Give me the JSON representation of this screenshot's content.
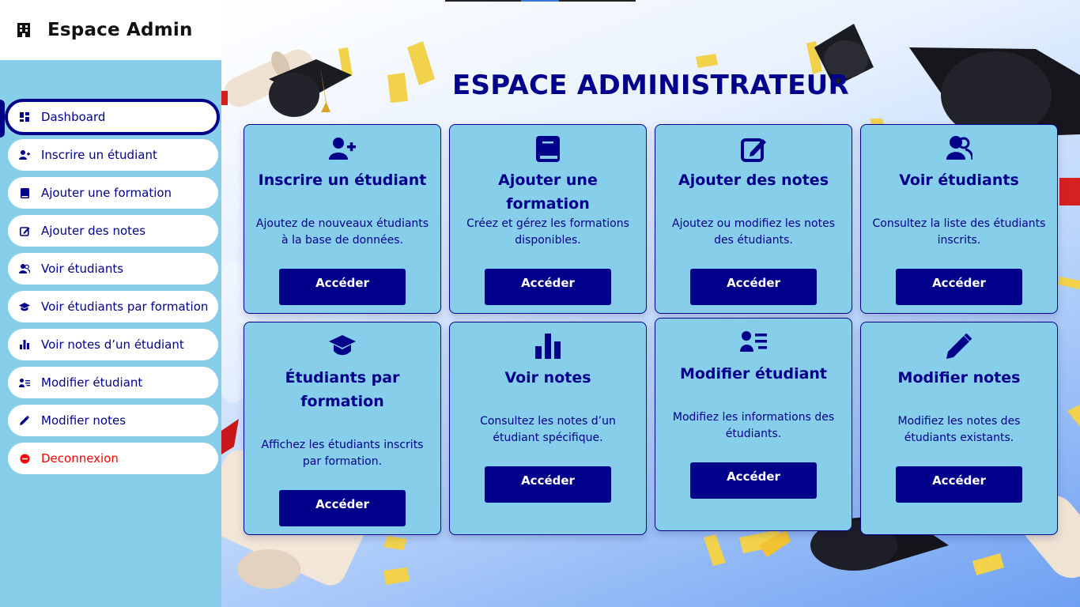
{
  "sidebar": {
    "title": "Espace Admin",
    "items": [
      {
        "label": "Dashboard",
        "icon": "dashboard-icon"
      },
      {
        "label": "Inscrire un étudiant",
        "icon": "user-plus-icon"
      },
      {
        "label": "Ajouter une formation",
        "icon": "book-icon"
      },
      {
        "label": "Ajouter des notes",
        "icon": "edit-icon"
      },
      {
        "label": "Voir étudiants",
        "icon": "users-icon"
      },
      {
        "label": "Voir étudiants par formation",
        "icon": "graduation-cap-icon"
      },
      {
        "label": "Voir notes d’un étudiant",
        "icon": "bar-chart-icon"
      },
      {
        "label": "Modifier étudiant",
        "icon": "user-list-icon"
      },
      {
        "label": "Modifier notes",
        "icon": "pencil-icon"
      },
      {
        "label": "Deconnexion",
        "icon": "logout-icon"
      }
    ]
  },
  "main": {
    "title": "ESPACE ADMINISTRATEUR",
    "cards": [
      {
        "title": "Inscrire un étudiant",
        "desc": "Ajoutez de nouveaux étudiants à la base de données.",
        "button": "Accéder",
        "icon": "user-plus-icon"
      },
      {
        "title": "Ajouter une formation",
        "desc": "Créez et gérez les formations disponibles.",
        "button": "Accéder",
        "icon": "book-icon"
      },
      {
        "title": "Ajouter des notes",
        "desc": "Ajoutez ou modifiez les notes des étudiants.",
        "button": "Accéder",
        "icon": "edit-icon"
      },
      {
        "title": "Voir étudiants",
        "desc": "Consultez la liste des étudiants inscrits.",
        "button": "Accéder",
        "icon": "users-icon"
      },
      {
        "title": "Étudiants par formation",
        "desc": "Affichez les étudiants inscrits par formation.",
        "button": "Accéder",
        "icon": "graduation-cap-icon"
      },
      {
        "title": "Voir notes",
        "desc": "Consultez les notes d’un étudiant spécifique.",
        "button": "Accéder",
        "icon": "bar-chart-icon"
      },
      {
        "title": "Modifier étudiant",
        "desc": "Modifiez les informations des étudiants.",
        "button": "Accéder",
        "icon": "user-list-icon"
      },
      {
        "title": "Modifier notes",
        "desc": "Modifiez les notes des étudiants existants.",
        "button": "Accéder",
        "icon": "pencil-icon"
      }
    ]
  },
  "colors": {
    "navy": "#00008b",
    "sky": "#87ceeb",
    "logout": "#ff0000"
  }
}
